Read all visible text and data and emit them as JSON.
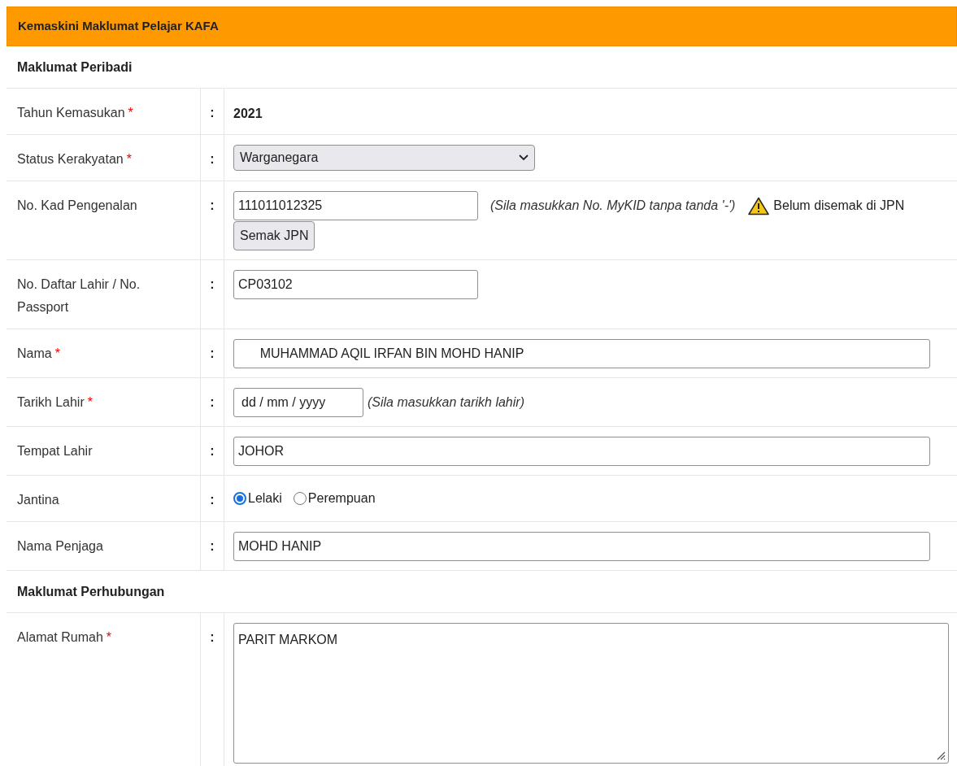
{
  "panel": {
    "title": "Kemaskini Maklumat Pelajar KAFA"
  },
  "sections": [
    {
      "title": "Maklumat Peribadi",
      "rows": [
        {
          "kind": "text",
          "label": "Tahun Kemasukan",
          "required_mark": "*",
          "separator": ":",
          "value": "2021"
        },
        {
          "kind": "select",
          "label": "Status Kerakyatan",
          "required_mark": "*",
          "separator": ":",
          "value": "Warganegara"
        },
        {
          "kind": "ic",
          "label": "No. Kad Pengenalan",
          "separator": ":",
          "value": "111011012325",
          "hint": "(Sila masukkan No. MyKID tanpa tanda '-')",
          "warning": "Belum disemak di JPN",
          "button": "Semak JPN"
        },
        {
          "kind": "input",
          "label": "No. Daftar Lahir / No. Passport",
          "separator": ":",
          "value": "CP03102"
        },
        {
          "kind": "wide",
          "label": "Nama",
          "required_mark": "*",
          "separator": ":",
          "value": "      MUHAMMAD AQIL IRFAN BIN MOHD HANIP"
        },
        {
          "kind": "date",
          "label": "Tarikh Lahir",
          "required_mark": "*",
          "separator": ":",
          "placeholder": "dd / mm / yyyy",
          "hint": "(Sila masukkan tarikh lahir)"
        },
        {
          "kind": "wide",
          "label": "Tempat Lahir",
          "separator": ":",
          "value": "JOHOR"
        },
        {
          "kind": "radio",
          "label": "Jantina",
          "separator": ":",
          "options": [
            {
              "label": "Lelaki",
              "selected": true
            },
            {
              "label": "Perempuan",
              "selected": false
            }
          ]
        },
        {
          "kind": "wide",
          "label": "Nama Penjaga",
          "separator": ":",
          "value": "MOHD HANIP"
        }
      ]
    },
    {
      "title": "Maklumat Perhubungan",
      "rows": [
        {
          "kind": "textarea",
          "label": "Alamat Rumah",
          "required_mark": "*",
          "separator": ":",
          "value": "PARIT MARKOM"
        }
      ]
    }
  ]
}
